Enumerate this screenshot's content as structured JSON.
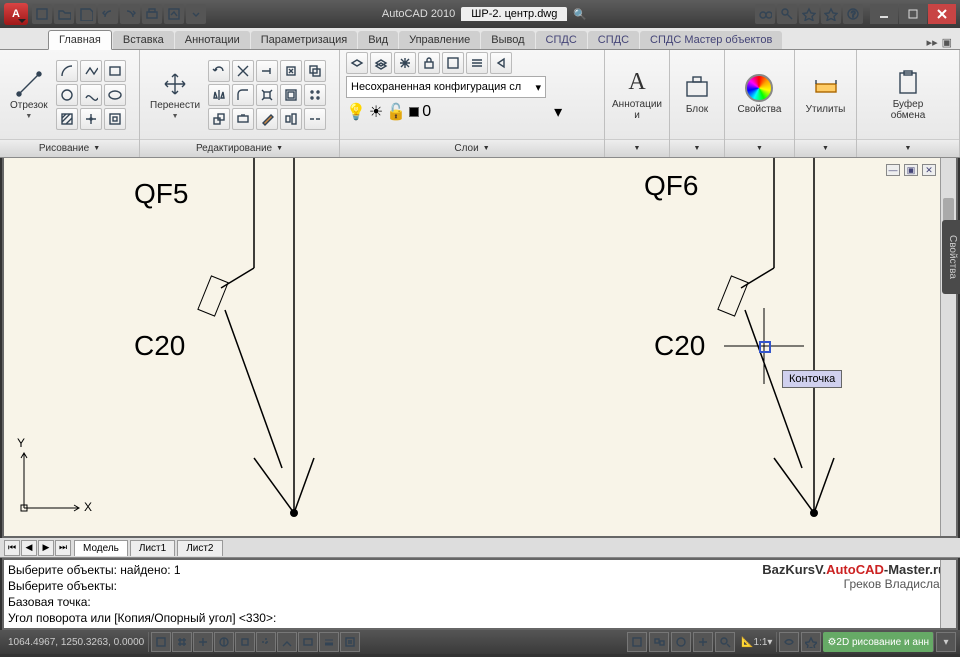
{
  "title": {
    "app": "AutoCAD 2010",
    "file": "ШР-2. центр.dwg"
  },
  "qat": [
    "new",
    "open",
    "save",
    "undo",
    "redo",
    "print",
    "plot",
    "more"
  ],
  "titleRight": [
    "binoculars",
    "key",
    "star",
    "star2",
    "help"
  ],
  "ribbonTabs": {
    "items": [
      "Главная",
      "Вставка",
      "Аннотации",
      "Параметризация",
      "Вид",
      "Управление",
      "Вывод",
      "СПДС",
      "СПДС",
      "СПДС Мастер объектов"
    ],
    "active": 0
  },
  "panels": {
    "draw": {
      "title": "Рисование",
      "main": "Отрезок"
    },
    "modify": {
      "title": "Редактирование",
      "main": "Перенести"
    },
    "layers": {
      "title": "Слои",
      "combo": "Несохраненная конфигурация сл",
      "current": "0"
    },
    "annot": {
      "title": "Аннотации",
      "sub": "и"
    },
    "block": {
      "title": "Блок"
    },
    "props": {
      "title": "Свойства"
    },
    "util": {
      "title": "Утилиты"
    },
    "clip": {
      "title": "Буфер",
      "sub": "обмена"
    }
  },
  "canvas": {
    "labels": {
      "qf5": "QF5",
      "qf6": "QF6",
      "c20a": "C20",
      "c20b": "C20",
      "y": "Y",
      "x": "X"
    },
    "tooltip": "Конточка"
  },
  "sidebar": {
    "props": "Свойства"
  },
  "sheets": {
    "tabs": [
      "Модель",
      "Лист1",
      "Лист2"
    ],
    "active": 0
  },
  "cmd": {
    "lines": [
      "Выберите объекты: найдено: 1",
      "Выберите объекты:",
      "Базовая точка:",
      "Угол поворота или [Копия/Опорный угол] <330>:"
    ]
  },
  "watermark": {
    "pre": "BazKursV.",
    "mid": "AutoCAD",
    "post": "-Master.ru",
    "author": "Греков Владислав"
  },
  "status": {
    "coords": "1064.4967, 1250.3263, 0.0000",
    "scale": "1:1",
    "workspace": "2D рисование и анн"
  }
}
